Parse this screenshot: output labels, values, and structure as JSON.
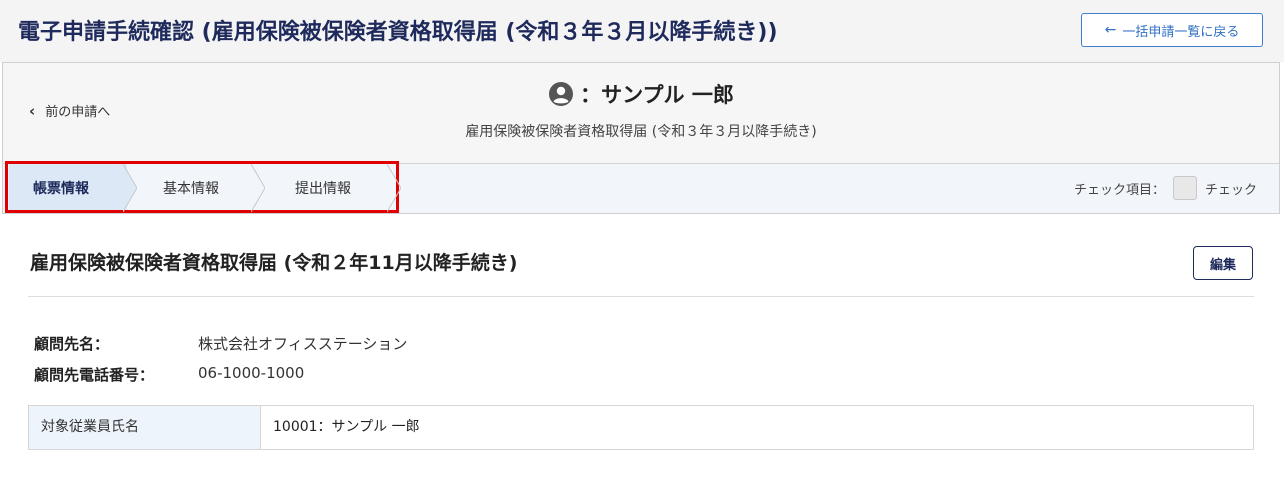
{
  "header": {
    "title": "電子申請手続確認 (雇用保険被保険者資格取得届 (令和３年３月以降手続き))",
    "back_button_label": "一括申請一覧に戻る",
    "back_button_arrow": "←"
  },
  "info": {
    "prev_link_label": "前の申請へ",
    "prev_link_chevron": "‹",
    "person_name": "：サンプル 一郎",
    "form_subtitle": "雇用保険被保険者資格取得届 (令和３年３月以降手続き)",
    "avatar_icon": "user-circle-icon"
  },
  "tabs": [
    {
      "label": "帳票情報",
      "active": true
    },
    {
      "label": "基本情報",
      "active": false
    },
    {
      "label": "提出情報",
      "active": false
    }
  ],
  "check": {
    "label": "チェック項目：",
    "checkbox_label": "チェック",
    "checked": false
  },
  "section": {
    "title": "雇用保険被保険者資格取得届 (令和２年11月以降手続き)",
    "edit_label": "編集"
  },
  "details": {
    "client_name_label": "顧問先名：",
    "client_name_value": "株式会社オフィスステーション",
    "client_phone_label": "顧問先電話番号：",
    "client_phone_value": "06-1000-1000"
  },
  "employee_table": {
    "header": "対象従業員氏名",
    "value": "10001：サンプル 一郎"
  },
  "colors": {
    "title": "#1f2a5c",
    "accent": "#3d7fcf",
    "active_tab_bg": "#dce8f6",
    "highlight": "#e00000"
  }
}
